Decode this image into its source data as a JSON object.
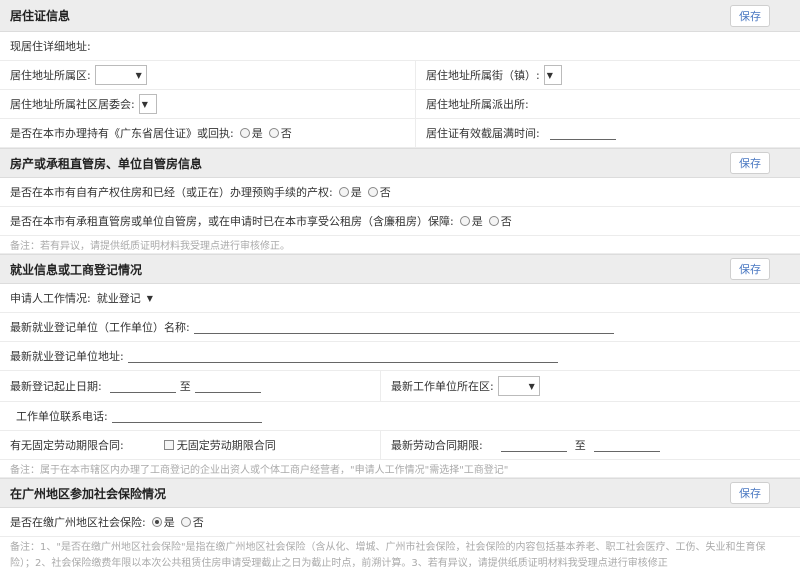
{
  "s1": {
    "title": "居住证信息",
    "save": "保存",
    "current_addr": "现居住详细地址:",
    "district": "居住地址所属区:",
    "street": "居住地址所属街（镇）:",
    "committee": "居住地址所属社区居委会:",
    "police": "居住地址所属派出所:",
    "q_permit": "是否在本市办理持有《广东省居住证》或回执:",
    "expiry": "居住证有效截届满时间:",
    "yes": "是",
    "no": "否"
  },
  "s2": {
    "title": "房产或承租直管房、单位自管房信息",
    "save": "保存",
    "q1": "是否在本市有自有产权住房和已经（或正在）办理预购手续的产权:",
    "q2": "是否在本市有承租直管房或单位自管房，或在申请时已在本市享受公租房（含廉租房）保障:",
    "yes": "是",
    "no": "否",
    "note": "备注：若有异议，请提供纸质证明材料我受理点进行审核修正。"
  },
  "s3": {
    "title": "就业信息或工商登记情况",
    "save": "保存",
    "work_status_label": "申请人工作情况:",
    "work_status_value": "就业登记",
    "unit_name": "最新就业登记单位（工作单位）名称:",
    "unit_addr": "最新就业登记单位地址:",
    "start_time": "最新登记起止日期:",
    "to": "至",
    "unit_district": "最新工作单位所在区:",
    "unit_phone": "工作单位联系电话:",
    "contract": "有无固定劳动期限合同:",
    "no_contract": "无固定劳动期限合同",
    "latest_contract": "最新劳动合同期限:",
    "to2": "至",
    "note": "备注：属于在本市辖区内办理了工商登记的企业出资人或个体工商户经营者，\"申请人工作情况\"需选择\"工商登记\""
  },
  "s4": {
    "title": "在广州地区参加社会保险情况",
    "save": "保存",
    "q": "是否在缴广州地区社会保险:",
    "yes": "是",
    "no": "否",
    "note1": "备注：1、\"是否在缴广州地区社会保险\"是指在缴广州地区社会保险（含从化、增城、广州市社会保险，社会保险的内容包括基本养老、职工社会医疗、工伤、失业和生育保",
    "note2": "险）；2、社会保险缴费年限以本次公共租赁住房申请受理截止之日为截止时点，前溯计算。3、若有异议，请提供纸质证明材料我受理点进行审核修正"
  }
}
